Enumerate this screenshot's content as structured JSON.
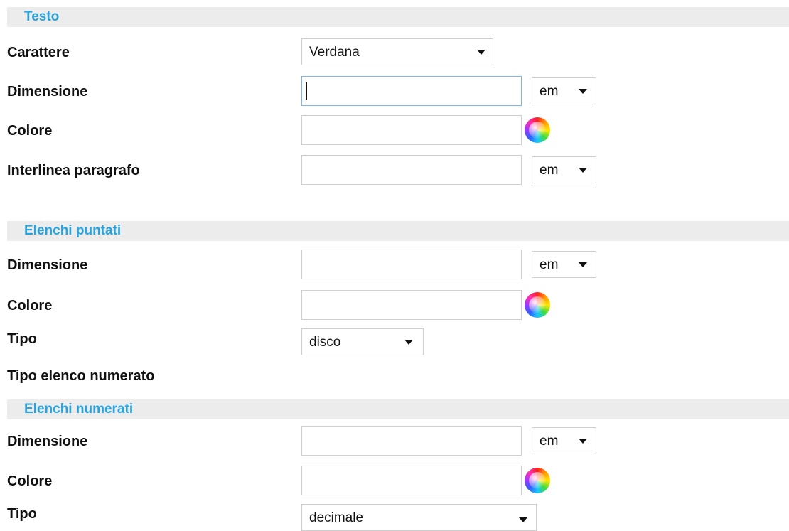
{
  "sections": {
    "testo": {
      "title": "Testo",
      "carattere": {
        "label": "Carattere",
        "value": "Verdana"
      },
      "dimensione": {
        "label": "Dimensione",
        "value": "",
        "unit": "em"
      },
      "colore": {
        "label": "Colore",
        "value": "",
        "icon": "color-wheel-icon"
      },
      "interlinea": {
        "label": "Interlinea paragrafo",
        "value": "",
        "unit": "em"
      }
    },
    "puntati": {
      "title": "Elenchi puntati",
      "dimensione": {
        "label": "Dimensione",
        "value": "",
        "unit": "em"
      },
      "colore": {
        "label": "Colore",
        "value": "",
        "icon": "color-wheel-icon"
      },
      "tipo": {
        "label": "Tipo",
        "value": "disco"
      }
    },
    "tipo_elenco_numerato_label": "Tipo elenco numerato",
    "numerati": {
      "title": "Elenchi numerati",
      "dimensione": {
        "label": "Dimensione",
        "value": "",
        "unit": "em"
      },
      "colore": {
        "label": "Colore",
        "value": "",
        "icon": "color-wheel-icon"
      },
      "tipo": {
        "label": "Tipo",
        "value": "decimale"
      }
    }
  },
  "colors": {
    "header_text": "#29a3dd",
    "header_bg": "#ececec",
    "focus_border": "#7eb4ea"
  }
}
